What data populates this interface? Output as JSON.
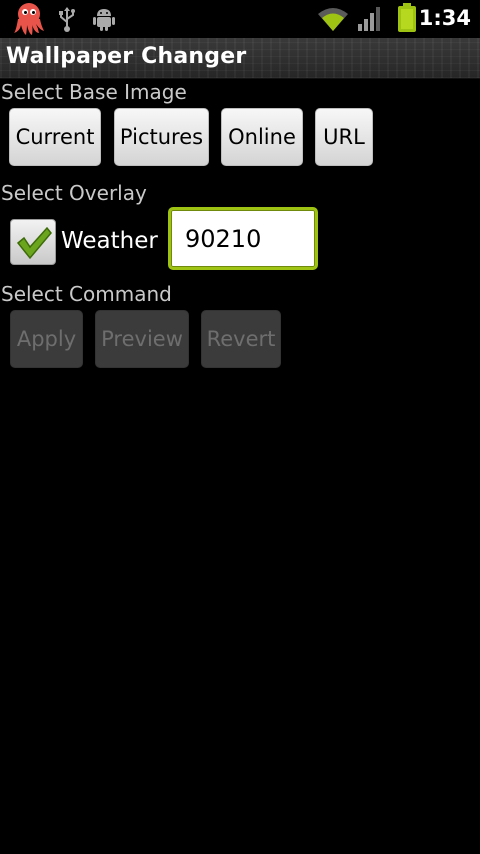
{
  "status_bar": {
    "time": "1:34",
    "icons": {
      "notification_1": "octopus-app-icon",
      "notification_2": "usb-icon",
      "notification_3": "android-debug-icon",
      "wifi": "wifi-icon",
      "signal": "signal-icon",
      "battery": "battery-icon"
    }
  },
  "app": {
    "title": "Wallpaper Changer"
  },
  "base_image": {
    "label": "Select Base Image",
    "buttons": [
      "Current",
      "Pictures",
      "Online",
      "URL"
    ]
  },
  "overlay": {
    "label": "Select Overlay",
    "checkbox_label": "Weather",
    "checkbox_checked": true,
    "zip_value": "90210"
  },
  "command": {
    "label": "Select Command",
    "buttons": [
      "Apply",
      "Preview",
      "Revert"
    ]
  },
  "colors": {
    "accent": "#9fc312",
    "check_green": "#6aa51d",
    "background": "#000000"
  }
}
